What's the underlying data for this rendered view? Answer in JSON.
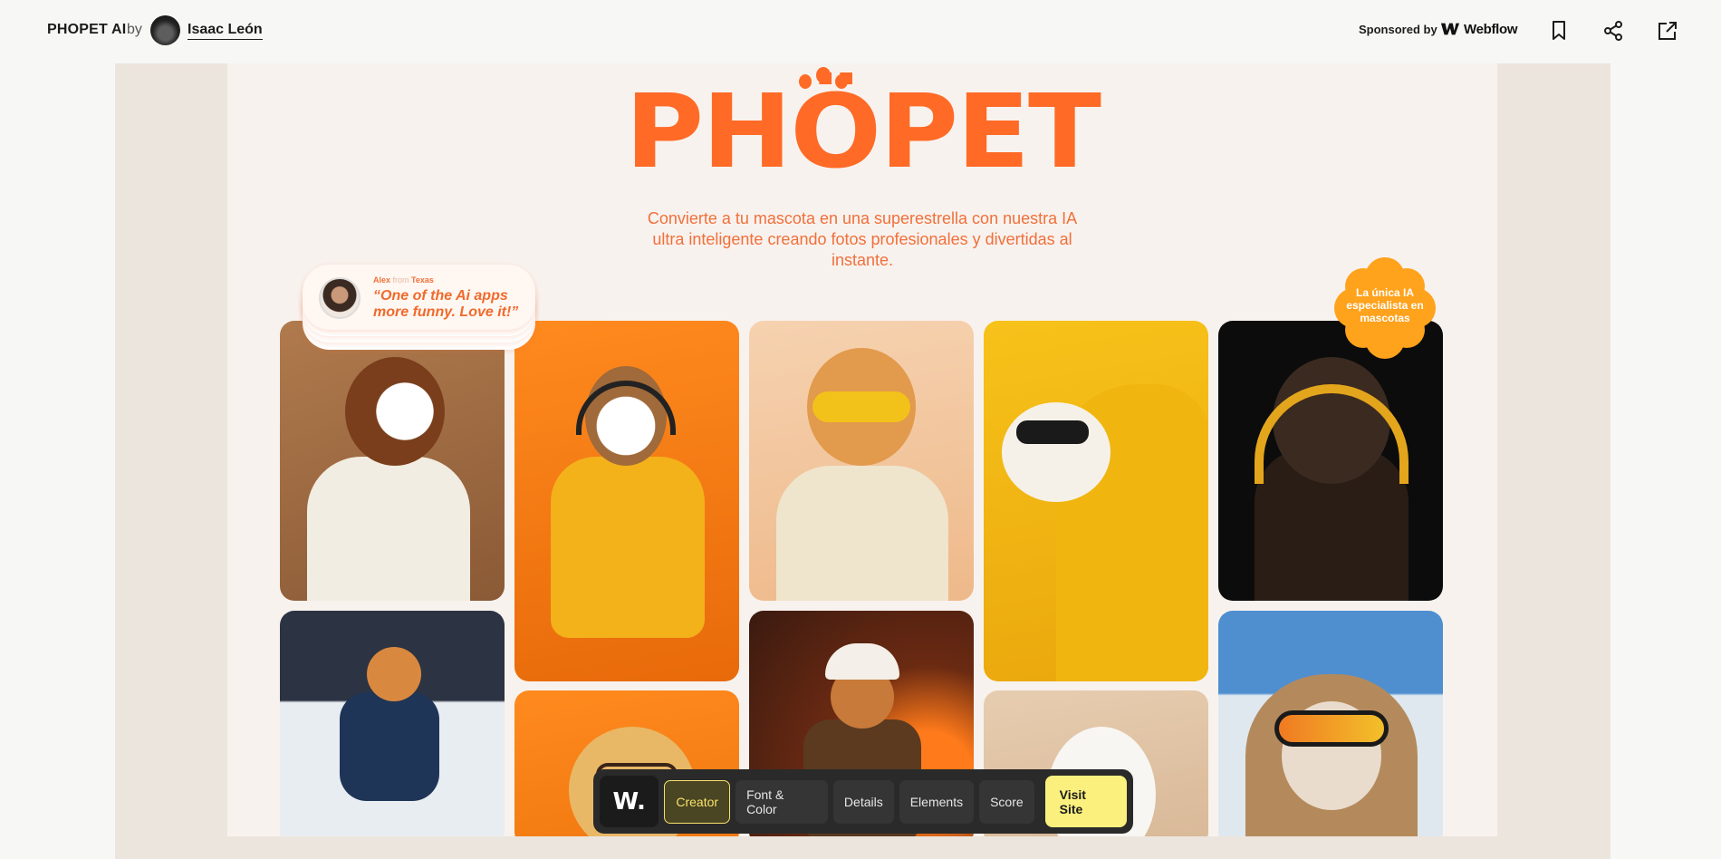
{
  "header": {
    "site_name": "PHOPET AI",
    "by_label": "by",
    "author_name": "Isaac León",
    "sponsored_label": "Sponsored by",
    "sponsor_name": "Webflow"
  },
  "preview": {
    "brand_name": "PHÖPET",
    "tagline": "Convierte a tu mascota en una superestrella con nuestra IA ultra inteligente creando fotos profesionales y divertidas al instante.",
    "testimonial": {
      "author": "Alex",
      "from_label": "from",
      "location": "Texas",
      "quote": "“One of the Ai apps more funny. Love it!”"
    },
    "badge_text": "La única IA especialista en mascotas"
  },
  "toolbar": {
    "logo": "W.",
    "tabs": [
      "Creator",
      "Font & Color",
      "Details",
      "Elements",
      "Score"
    ],
    "active_tab": "Creator",
    "visit_label": "Visit Site"
  },
  "colors": {
    "brand_orange": "#ff6a26",
    "badge_orange": "#ffa21c",
    "toolbar_bg": "#2a2a2a",
    "visit_yellow": "#fbf07d"
  },
  "icons": [
    "bookmark-icon",
    "share-icon",
    "external-link-icon"
  ]
}
